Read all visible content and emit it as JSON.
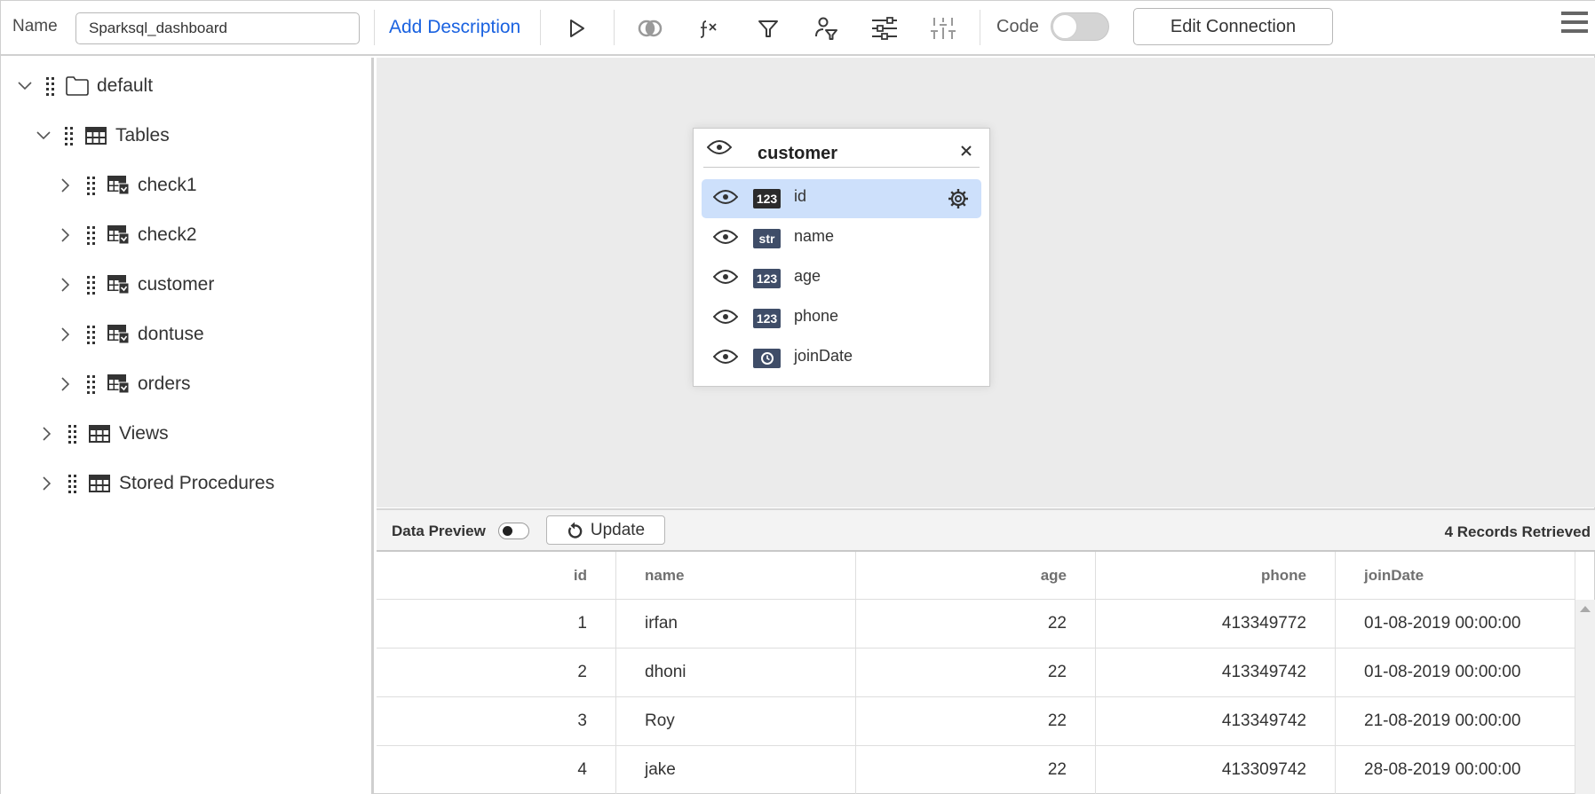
{
  "toolbar": {
    "name_label": "Name",
    "name_value": "Sparksql_dashboard",
    "add_description": "Add Description",
    "icons": [
      "run-icon",
      "join-icon",
      "expression-icon",
      "filter-icon",
      "user-filter-icon",
      "settings-sliders-icon",
      "column-settings-icon"
    ],
    "code_label": "Code",
    "code_toggle_on": false,
    "edit_connection": "Edit Connection",
    "menu_icon": "hamburger-menu-icon"
  },
  "sidebar": {
    "root": {
      "label": "default",
      "icon": "folder-icon",
      "expanded": true
    },
    "groups": [
      {
        "label": "Tables",
        "icon": "table-icon",
        "expanded": true,
        "items": [
          {
            "label": "check1",
            "icon": "table-check-icon"
          },
          {
            "label": "check2",
            "icon": "table-check-icon"
          },
          {
            "label": "customer",
            "icon": "table-check-icon"
          },
          {
            "label": "dontuse",
            "icon": "table-check-icon"
          },
          {
            "label": "orders",
            "icon": "table-check-icon"
          }
        ]
      },
      {
        "label": "Views",
        "icon": "table-icon",
        "expanded": false
      },
      {
        "label": "Stored Procedures",
        "icon": "table-icon",
        "expanded": false
      }
    ]
  },
  "table_card": {
    "title": "customer",
    "columns": [
      {
        "name": "id",
        "type": "123",
        "selected": true
      },
      {
        "name": "name",
        "type": "str",
        "selected": false
      },
      {
        "name": "age",
        "type": "123",
        "selected": false
      },
      {
        "name": "phone",
        "type": "123",
        "selected": false
      },
      {
        "name": "joinDate",
        "type": "clock",
        "selected": false
      }
    ]
  },
  "preview": {
    "label": "Data Preview",
    "toggle_on": true,
    "update_label": "Update",
    "records_text": "4 Records Retrieved",
    "headers": [
      "id",
      "name",
      "age",
      "phone",
      "joinDate"
    ],
    "rows": [
      [
        "1",
        "irfan",
        "22",
        "413349772",
        "01-08-2019 00:00:00"
      ],
      [
        "2",
        "dhoni",
        "22",
        "413349742",
        "01-08-2019 00:00:00"
      ],
      [
        "3",
        "Roy",
        "22",
        "413349742",
        "21-08-2019 00:00:00"
      ],
      [
        "4",
        "jake",
        "22",
        "413309742",
        "28-08-2019 00:00:00"
      ]
    ]
  },
  "colors": {
    "accent_link": "#1a62e0",
    "selected_row": "#cde0fb",
    "type_badge": "#3f4d68",
    "canvas_bg": "#ebebeb"
  }
}
